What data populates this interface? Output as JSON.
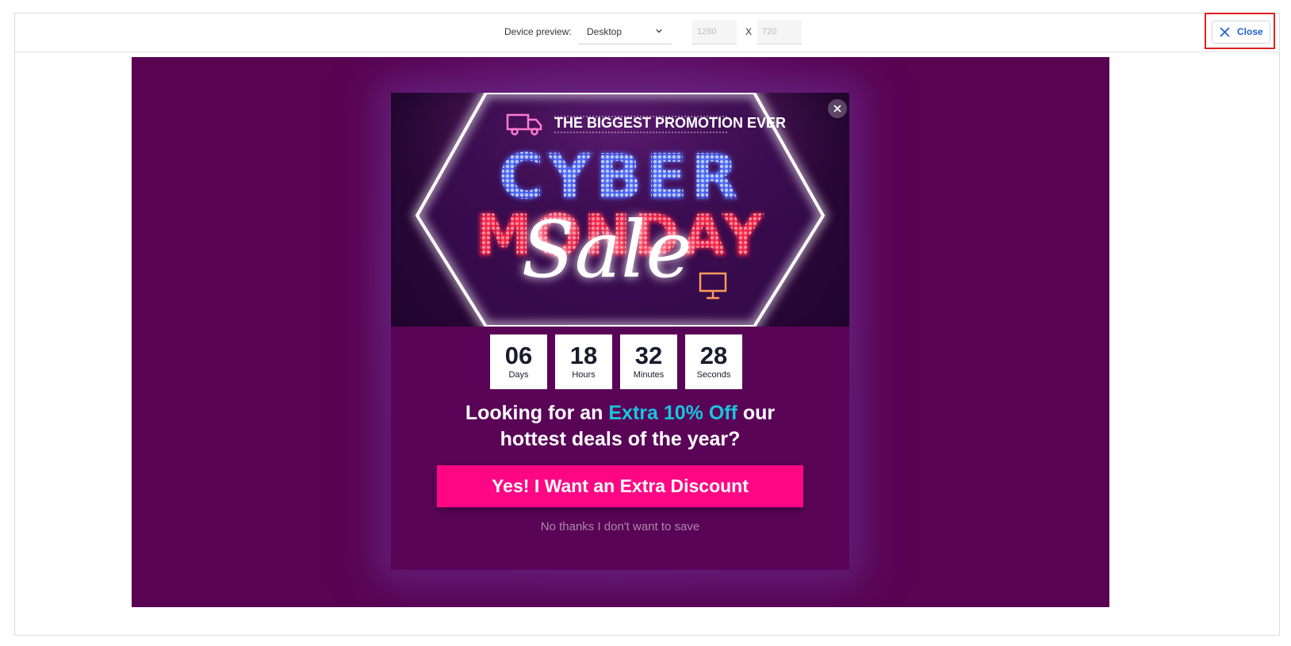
{
  "toolbar": {
    "device_label": "Device preview:",
    "device_value": "Desktop",
    "width_value": "1280",
    "x_separator": "X",
    "height_value": "720",
    "close_label": "Close"
  },
  "popup": {
    "tagline": "THE BIGGEST PROMOTION EVER",
    "title_line1": "CYBER",
    "title_line2": "MONDAY",
    "title_script": "Sale",
    "countdown": [
      {
        "value": "06",
        "unit": "Days"
      },
      {
        "value": "18",
        "unit": "Hours"
      },
      {
        "value": "32",
        "unit": "Minutes"
      },
      {
        "value": "28",
        "unit": "Seconds"
      }
    ],
    "headline_pre": "Looking for an ",
    "headline_accent": "Extra 10% Off",
    "headline_post": " our",
    "headline_line2": "hottest deals of the year?",
    "cta_label": "Yes! I Want an Extra Discount",
    "decline_label": "No thanks I don't want to save"
  },
  "colors": {
    "stage_bg": "#590353",
    "accent": "#16c6dd",
    "cta_bg": "#ff0784",
    "close_text": "#1f63c9"
  }
}
